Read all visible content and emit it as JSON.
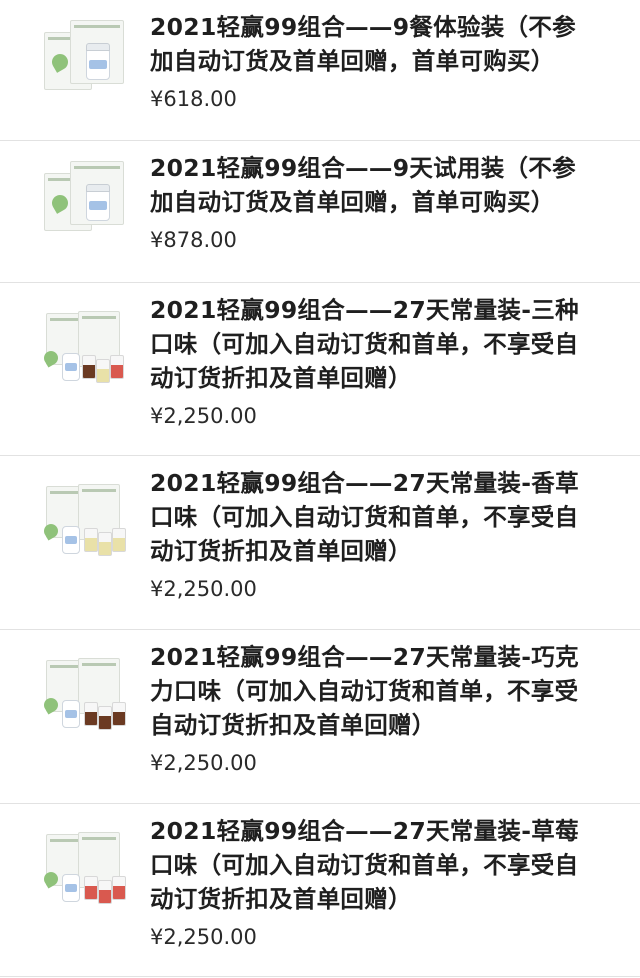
{
  "products": [
    {
      "title": "2021轻赢99组合——9餐体验装（不参加自动订货及首单回赠，首单可购买）",
      "price": "¥618.00",
      "thumb": "small-set",
      "accent": "#8fc27a"
    },
    {
      "title": "2021轻赢99组合——9天试用装（不参加自动订货及首单回赠，首单可购买）",
      "price": "¥878.00",
      "thumb": "small-set",
      "accent": "#8fc27a"
    },
    {
      "title": "2021轻赢99组合——27天常量装-三种口味（可加入自动订货和首单，不享受自动订货折扣及首单回赠）",
      "price": "¥2,250.00",
      "thumb": "mixed",
      "accent": "#c9a24a"
    },
    {
      "title": "2021轻赢99组合——27天常量装-香草口味（可加入自动订货和首单，不享受自动订货折扣及首单回赠）",
      "price": "¥2,250.00",
      "thumb": "vanilla",
      "accent": "#e9e1a8"
    },
    {
      "title": "2021轻赢99组合——27天常量装-巧克力口味（可加入自动订货和首单，不享受自动订货折扣及首单回赠）",
      "price": "¥2,250.00",
      "thumb": "chocolate",
      "accent": "#6b3a22"
    },
    {
      "title": "2021轻赢99组合——27天常量装-草莓口味（可加入自动订货和首单，不享受自动订货折扣及首单回赠）",
      "price": "¥2,250.00",
      "thumb": "strawberry",
      "accent": "#d9594f"
    }
  ]
}
